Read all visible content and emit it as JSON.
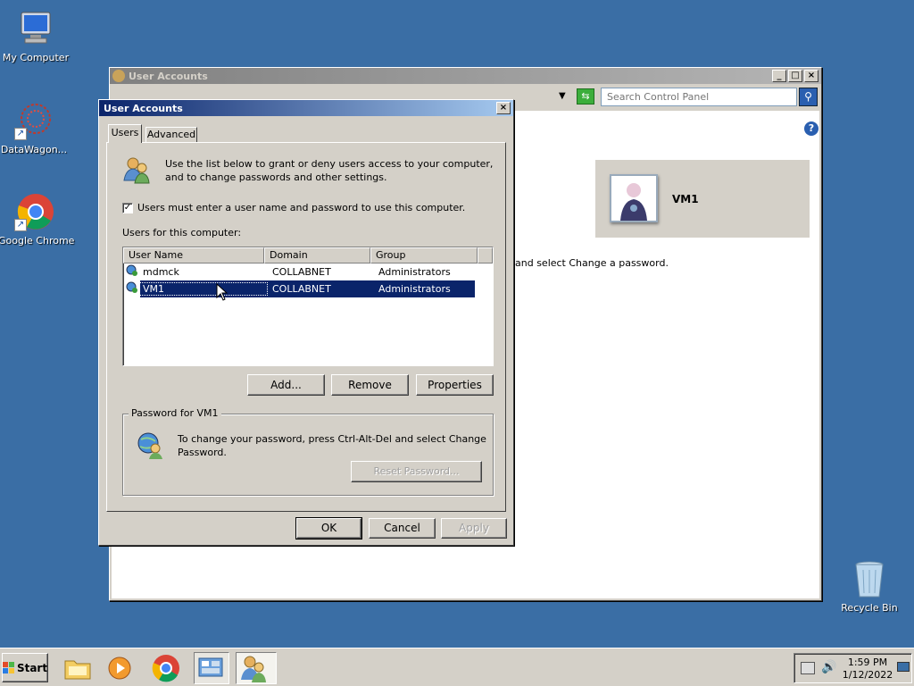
{
  "desktop": {
    "icons": [
      {
        "label": "My Computer",
        "icon": "computer-icon"
      },
      {
        "label": "DataWagon...",
        "icon": "datawagon-icon"
      },
      {
        "label": "Google Chrome",
        "icon": "chrome-icon"
      },
      {
        "label": "Recycle Bin",
        "icon": "recycle-bin-icon"
      }
    ]
  },
  "bg_window": {
    "title": "User Accounts",
    "search_placeholder": "Search Control Panel",
    "user_name": "VM1",
    "partial_text": "and select Change a password."
  },
  "dialog": {
    "title": "User Accounts",
    "tabs": [
      "Users",
      "Advanced"
    ],
    "intro_text_line1": "Use the list below to grant or deny users access to your computer,",
    "intro_text_line2": "and to change passwords and other settings.",
    "checkbox_label": "Users must enter a user name and password to use this computer.",
    "checkbox_checked": true,
    "users_label": "Users for this computer:",
    "columns": [
      "User Name",
      "Domain",
      "Group"
    ],
    "rows": [
      {
        "name": "mdmck",
        "domain": "COLLABNET",
        "group": "Administrators",
        "selected": false
      },
      {
        "name": "VM1",
        "domain": "COLLABNET",
        "group": "Administrators",
        "selected": true
      }
    ],
    "add_label": "Add...",
    "remove_label": "Remove",
    "properties_label": "Properties",
    "password_group_label": "Password for VM1",
    "password_text_line1": "To change your password, press Ctrl-Alt-Del and select Change",
    "password_text_line2": "Password.",
    "reset_label": "Reset Password...",
    "ok_label": "OK",
    "cancel_label": "Cancel",
    "apply_label": "Apply"
  },
  "taskbar": {
    "start_label": "Start",
    "time": "1:59 PM",
    "date": "1/12/2022"
  },
  "colors": {
    "desktop": "#3a6ea5",
    "selection": "#0a246a",
    "window_face": "#d4d0c8"
  }
}
